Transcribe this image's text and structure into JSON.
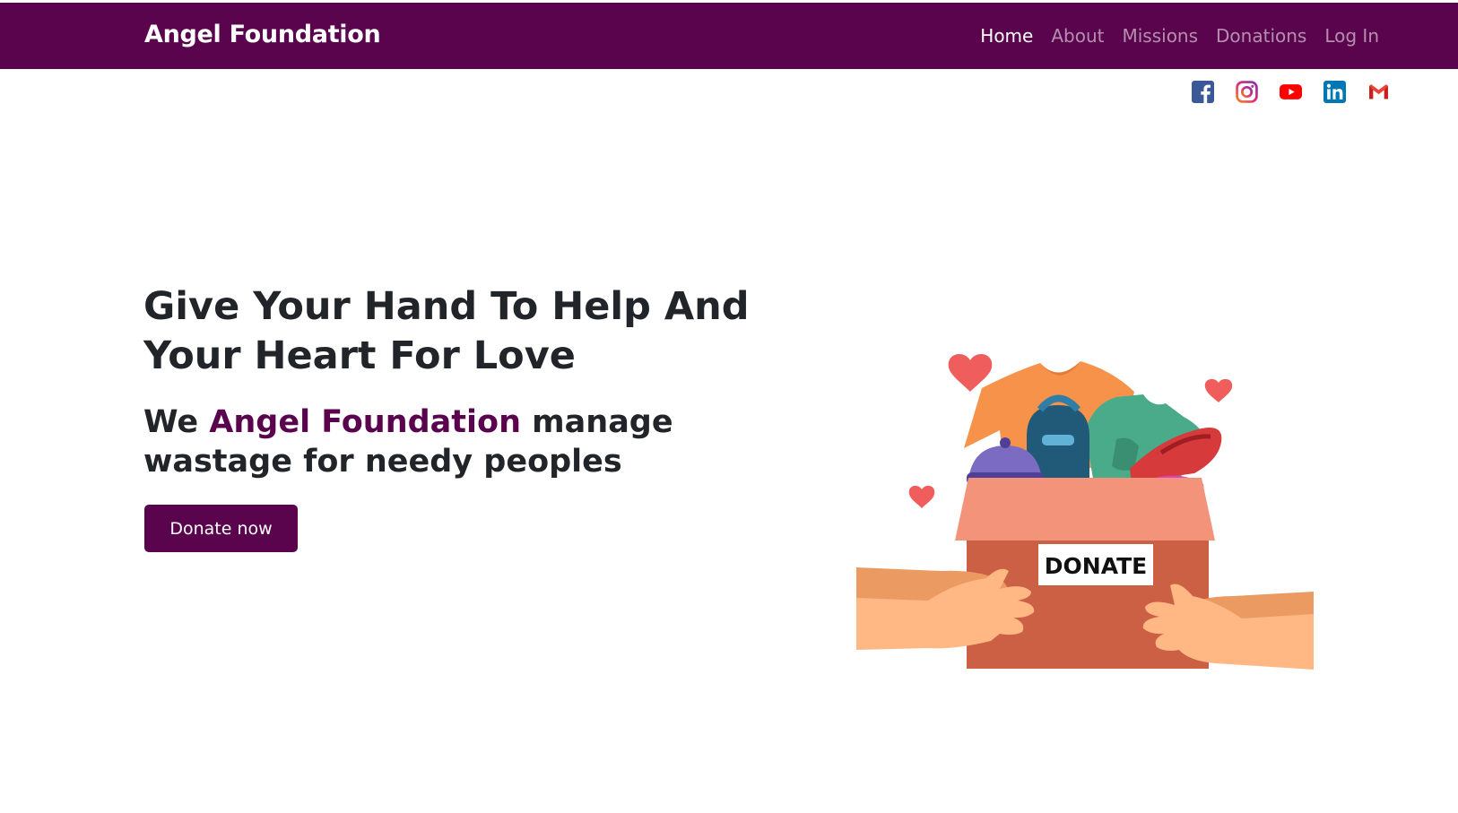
{
  "navbar": {
    "brand": "Angel Foundation",
    "links": [
      {
        "label": "Home",
        "active": true
      },
      {
        "label": "About",
        "active": false
      },
      {
        "label": "Missions",
        "active": false
      },
      {
        "label": "Donations",
        "active": false
      },
      {
        "label": "Log In",
        "active": false
      }
    ]
  },
  "socials": [
    {
      "icon": "facebook-icon",
      "color": "#3b5998"
    },
    {
      "icon": "instagram-icon",
      "color": "#c13584"
    },
    {
      "icon": "youtube-icon",
      "color": "#ff0000"
    },
    {
      "icon": "linkedin-icon",
      "color": "#0077b5"
    },
    {
      "icon": "gmail-icon",
      "color": "#ea4335"
    }
  ],
  "hero": {
    "title": "Give Your Hand To Help And Your Heart For Love",
    "subtitle_prefix": "We ",
    "subtitle_accent": "Angel Foundation",
    "subtitle_suffix": " manage wastage for needy peoples",
    "button_label": "Donate now"
  },
  "illustration": {
    "box_label": "DONATE"
  },
  "colors": {
    "brand": "#5a044e",
    "text": "#212529",
    "nav_inactive": "rgba(255,255,255,0.55)"
  }
}
